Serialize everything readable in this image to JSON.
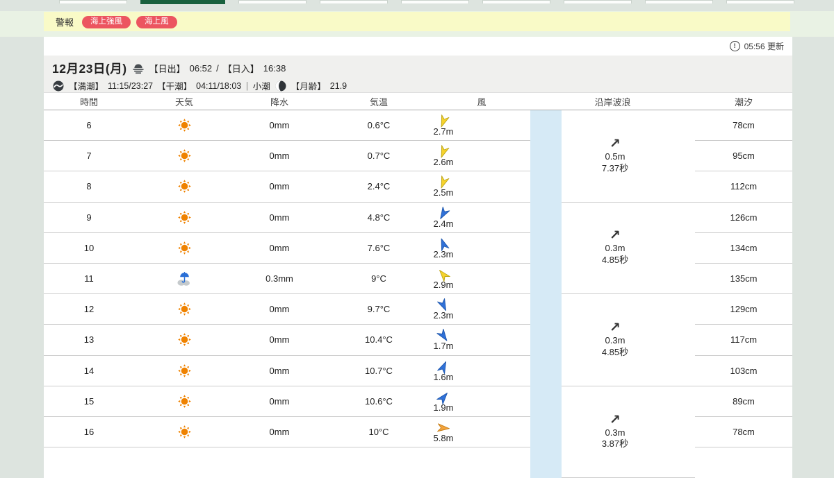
{
  "top_nav": {
    "tab_count": 9,
    "active_index": 1
  },
  "alert_bar": {
    "label": "警報",
    "warnings": [
      "海上強風",
      "海上風"
    ],
    "badge_color": "#ec5560"
  },
  "update_bar": {
    "info_icon": "!",
    "updated_text": "05:56 更新"
  },
  "date_header": {
    "date": "12月23日(月)",
    "sunrise_label": "【日出】",
    "sunrise_time": "06:52",
    "separator": "/",
    "sunset_label": "【日入】",
    "sunset_time": "16:38",
    "high_tide_label": "【満潮】",
    "high_tide_times": "11:15/23:27",
    "low_tide_label": "【干潮】",
    "low_tide_times": "04:11/18:03",
    "divider": "｜",
    "tide_phase": "小潮",
    "moon_age_label": "【月齢】",
    "moon_age": "21.9"
  },
  "table": {
    "headers": [
      "時間",
      "天気",
      "降水",
      "気温",
      "風",
      "沿岸波浪",
      "潮汐"
    ],
    "wind_colors": {
      "yellow": {
        "fill": "#f6d32d",
        "stroke": "#bca414"
      },
      "blue": {
        "fill": "#3071d8",
        "stroke": "#1d56ad"
      },
      "orange": {
        "fill": "#f2a33c",
        "stroke": "#c77e18"
      }
    },
    "band_color": "#d6eaf6",
    "rows": [
      {
        "time": "6",
        "weather": "sunny",
        "precip": "0mm",
        "temp": "0.6°C",
        "wind_speed": "2.7m",
        "wind_deg": 200,
        "wind_color": "yellow",
        "tide": "78cm"
      },
      {
        "time": "7",
        "weather": "sunny",
        "precip": "0mm",
        "temp": "0.7°C",
        "wind_speed": "2.6m",
        "wind_deg": 200,
        "wind_color": "yellow",
        "tide": "95cm"
      },
      {
        "time": "8",
        "weather": "sunny",
        "precip": "0mm",
        "temp": "2.4°C",
        "wind_speed": "2.5m",
        "wind_deg": 200,
        "wind_color": "yellow",
        "tide": "112cm"
      },
      {
        "time": "9",
        "weather": "sunny",
        "precip": "0mm",
        "temp": "4.8°C",
        "wind_speed": "2.4m",
        "wind_deg": 210,
        "wind_color": "blue",
        "tide": "126cm"
      },
      {
        "time": "10",
        "weather": "sunny",
        "precip": "0mm",
        "temp": "7.6°C",
        "wind_speed": "2.3m",
        "wind_deg": 340,
        "wind_color": "blue",
        "tide": "134cm"
      },
      {
        "time": "11",
        "weather": "rain",
        "precip": "0.3mm",
        "temp": "9°C",
        "wind_speed": "2.9m",
        "wind_deg": 320,
        "wind_color": "yellow",
        "tide": "135cm"
      },
      {
        "time": "12",
        "weather": "sunny",
        "precip": "0mm",
        "temp": "9.7°C",
        "wind_speed": "2.3m",
        "wind_deg": 155,
        "wind_color": "blue",
        "tide": "129cm"
      },
      {
        "time": "13",
        "weather": "sunny",
        "precip": "0mm",
        "temp": "10.4°C",
        "wind_speed": "1.7m",
        "wind_deg": 145,
        "wind_color": "blue",
        "tide": "117cm"
      },
      {
        "time": "14",
        "weather": "sunny",
        "precip": "0mm",
        "temp": "10.7°C",
        "wind_speed": "1.6m",
        "wind_deg": 25,
        "wind_color": "blue",
        "tide": "103cm"
      },
      {
        "time": "15",
        "weather": "sunny",
        "precip": "0mm",
        "temp": "10.6°C",
        "wind_speed": "1.9m",
        "wind_deg": 40,
        "wind_color": "blue",
        "tide": "89cm"
      },
      {
        "time": "16",
        "weather": "sunny",
        "precip": "0mm",
        "temp": "10°C",
        "wind_speed": "5.8m",
        "wind_deg": 95,
        "wind_color": "orange",
        "tide": "78cm"
      }
    ],
    "wave_groups": [
      {
        "arrow": "↗",
        "height": "0.5m",
        "period": "7.37秒"
      },
      {
        "arrow": "↗",
        "height": "0.3m",
        "period": "4.85秒"
      },
      {
        "arrow": "↗",
        "height": "0.3m",
        "period": "4.85秒"
      },
      {
        "arrow": "↗",
        "height": "0.3m",
        "period": "3.87秒"
      }
    ]
  }
}
